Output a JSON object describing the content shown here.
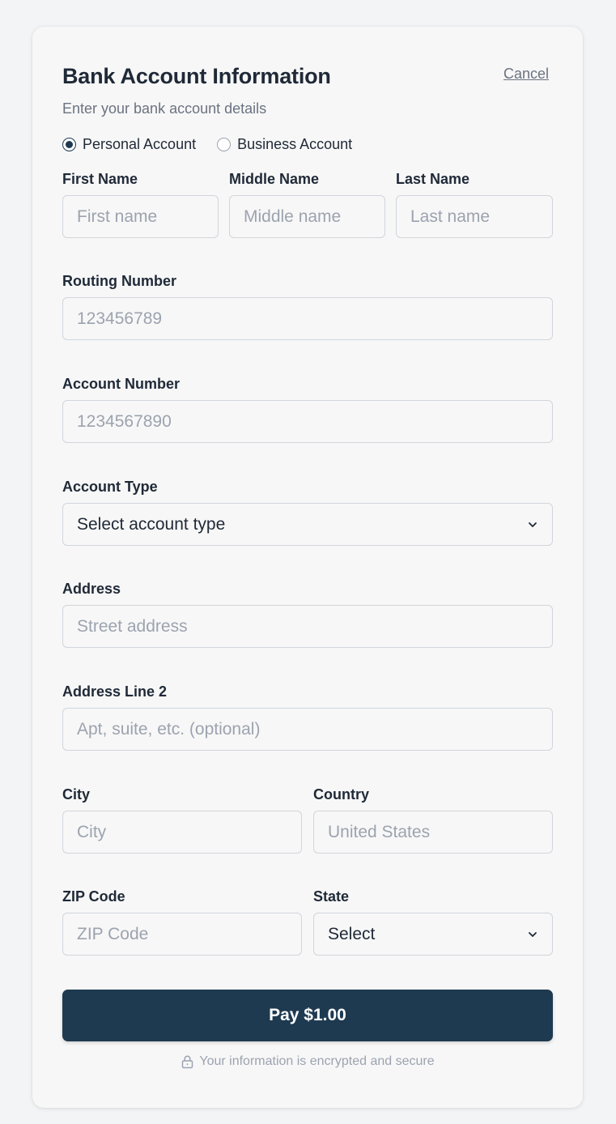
{
  "header": {
    "title": "Bank Account Information",
    "cancel_label": "Cancel",
    "subtitle": "Enter your bank account details"
  },
  "account_kind": {
    "options": [
      {
        "label": "Personal Account",
        "checked": true
      },
      {
        "label": "Business Account",
        "checked": false
      }
    ]
  },
  "fields": {
    "first_name": {
      "label": "First Name",
      "placeholder": "First name",
      "value": ""
    },
    "middle_name": {
      "label": "Middle Name",
      "placeholder": "Middle name",
      "value": ""
    },
    "last_name": {
      "label": "Last Name",
      "placeholder": "Last name",
      "value": ""
    },
    "routing_number": {
      "label": "Routing Number",
      "placeholder": "123456789",
      "value": ""
    },
    "account_number": {
      "label": "Account Number",
      "placeholder": "1234567890",
      "value": ""
    },
    "account_type": {
      "label": "Account Type",
      "selected": "Select account type"
    },
    "address": {
      "label": "Address",
      "placeholder": "Street address",
      "value": ""
    },
    "address_line2": {
      "label": "Address Line 2",
      "placeholder": "Apt, suite, etc. (optional)",
      "value": ""
    },
    "city": {
      "label": "City",
      "placeholder": "City",
      "value": ""
    },
    "country": {
      "label": "Country",
      "placeholder": "United States",
      "value": ""
    },
    "zip": {
      "label": "ZIP Code",
      "placeholder": "ZIP Code",
      "value": ""
    },
    "state": {
      "label": "State",
      "selected": "Select"
    }
  },
  "submit": {
    "label": "Pay $1.00"
  },
  "footer": {
    "secure_note": "Your information is encrypted and secure",
    "icon": "lock-icon"
  },
  "colors": {
    "primary": "#1e3a51",
    "background": "#f7f7f7",
    "muted_text": "#9ca3af"
  }
}
